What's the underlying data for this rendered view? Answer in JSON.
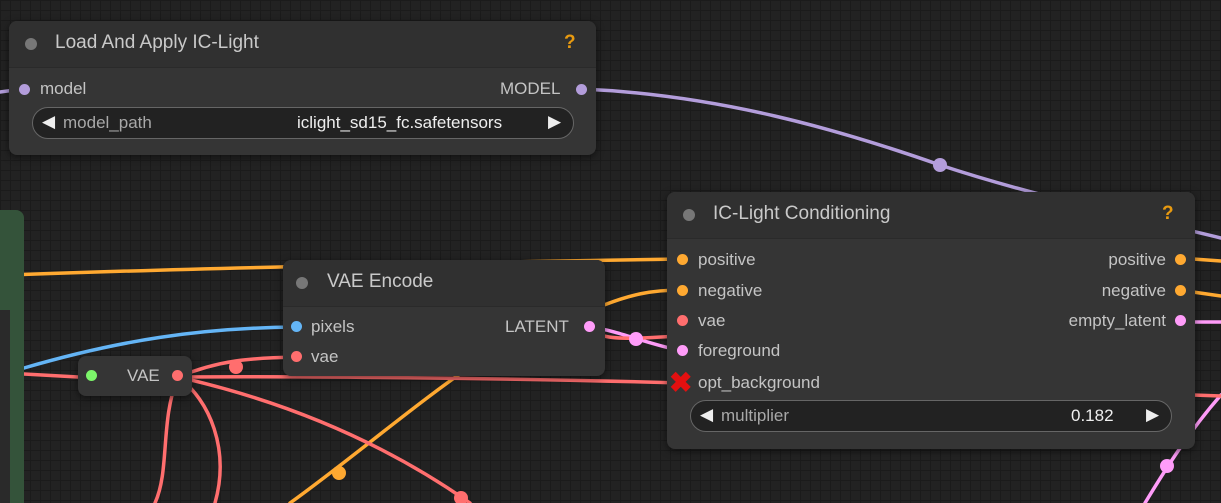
{
  "colors": {
    "model_link": "#b39ddb",
    "conditioning_link": "#ffa931",
    "vae_link": "#ff6e6e",
    "image_link": "#64b5f6",
    "latent_link": "#ff9cf9",
    "help": "#e89a10"
  },
  "nodes": {
    "load_ic_light": {
      "title": "Load And Apply IC-Light",
      "help": "?",
      "input_model": "model",
      "output_model": "MODEL",
      "widget": {
        "label": "model_path",
        "value": "iclight_sd15_fc.safetensors"
      }
    },
    "ic_light_conditioning": {
      "title": "IC-Light Conditioning",
      "help": "?",
      "inputs": [
        "positive",
        "negative",
        "vae",
        "foreground",
        "opt_background"
      ],
      "outputs": [
        "positive",
        "negative",
        "empty_latent"
      ],
      "widget": {
        "label": "multiplier",
        "value": "0.182"
      }
    },
    "vae_encode": {
      "title": "VAE Encode",
      "inputs": [
        "pixels",
        "vae"
      ],
      "output": "LATENT"
    },
    "vae_reroute": {
      "label": "VAE"
    }
  }
}
